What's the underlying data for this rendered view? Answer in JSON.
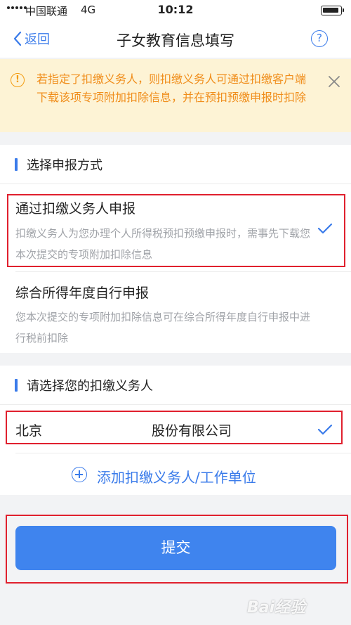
{
  "status_bar": {
    "carrier": "中国联通",
    "network": "4G",
    "time": "10:12"
  },
  "nav": {
    "back_label": "返回",
    "title": "子女教育信息填写",
    "help_label": "?"
  },
  "notice": {
    "icon_text": "!",
    "text": "若指定了扣缴义务人，则扣缴义务人可通过扣缴客户端下载该项专项附加扣除信息，并在预扣预缴申报时扣除"
  },
  "method_section": {
    "heading": "选择申报方式",
    "options": [
      {
        "title": "通过扣缴义务人申报",
        "desc": "扣缴义务人为您办理个人所得税预扣预缴申报时，需事先下载您本次提交的专项附加扣除信息",
        "selected": true
      },
      {
        "title": "综合所得年度自行申报",
        "desc": "您本次提交的专项附加扣除信息可在综合所得年度自行申报中进行税前扣除",
        "selected": false
      }
    ]
  },
  "withholding_section": {
    "heading": "请选择您的扣缴义务人",
    "company_prefix": "北京",
    "company_suffix": "股份有限公司",
    "add_label": "添加扣缴义务人/工作单位"
  },
  "submit_label": "提交",
  "watermark": "Bai经验",
  "colors": {
    "accent": "#3a7bea",
    "button": "#3f84ee",
    "notice_bg": "#fdf3d5",
    "notice_text": "#f08d1a",
    "highlight": "#e0202e"
  }
}
